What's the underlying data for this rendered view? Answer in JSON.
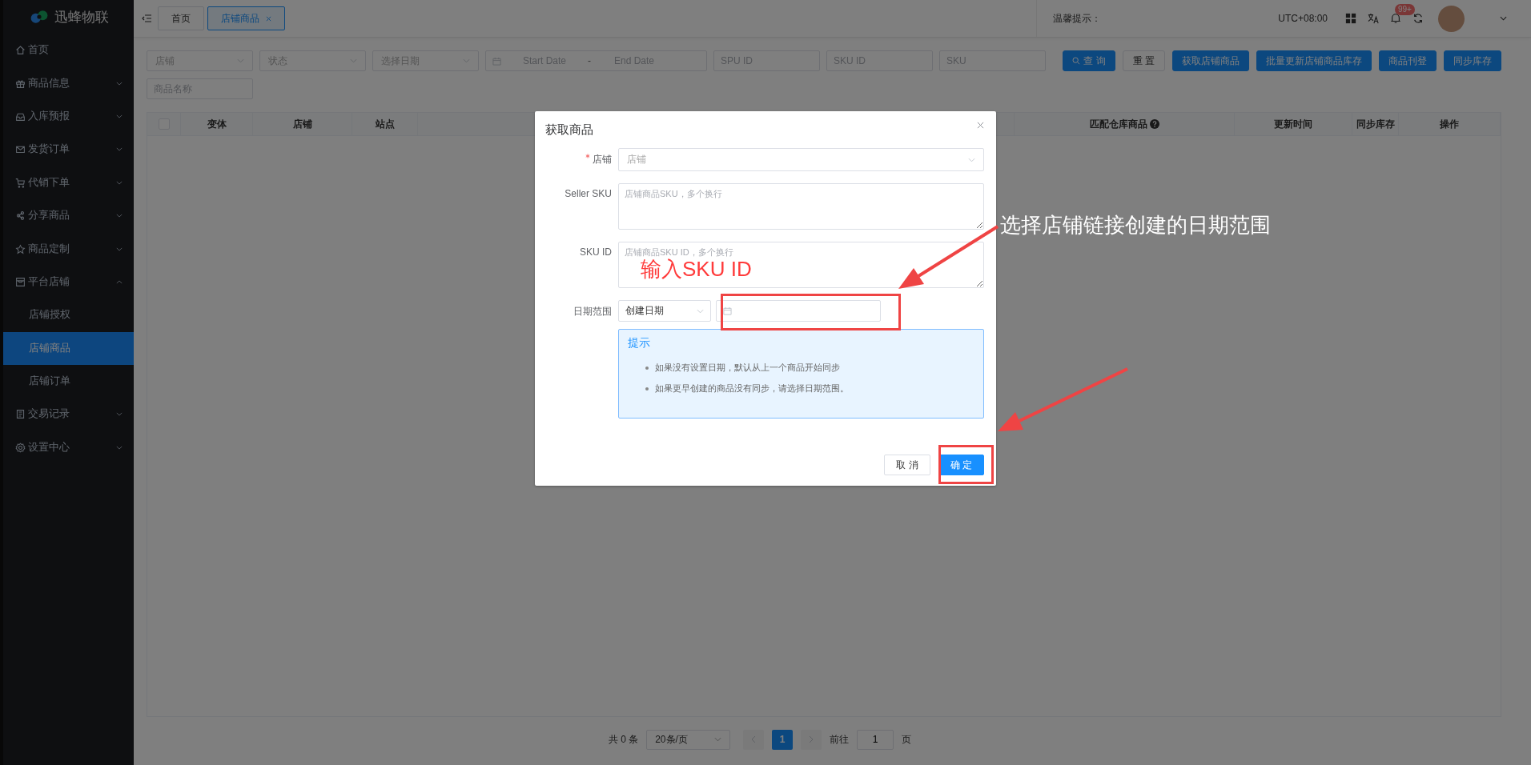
{
  "brand": {
    "name": "迅蜂物联"
  },
  "sidebar": {
    "items": [
      {
        "kind": "link",
        "label": "首页"
      },
      {
        "kind": "group",
        "label": "商品信息",
        "expanded": false
      },
      {
        "kind": "group",
        "label": "入库预报",
        "expanded": false
      },
      {
        "kind": "group",
        "label": "发货订单",
        "expanded": false
      },
      {
        "kind": "group",
        "label": "代销下单",
        "expanded": false
      },
      {
        "kind": "group",
        "label": "分享商品",
        "expanded": false
      },
      {
        "kind": "group",
        "label": "商品定制",
        "expanded": false
      },
      {
        "kind": "group",
        "label": "平台店铺",
        "expanded": true,
        "children": [
          {
            "label": "店铺授权",
            "selected": false
          },
          {
            "label": "店铺商品",
            "selected": true
          },
          {
            "label": "店铺订单",
            "selected": false
          }
        ]
      },
      {
        "kind": "group",
        "label": "交易记录",
        "expanded": false
      },
      {
        "kind": "group",
        "label": "设置中心",
        "expanded": false
      }
    ]
  },
  "tabs": [
    {
      "label": "首页",
      "selected": false,
      "closable": false
    },
    {
      "label": "店铺商品",
      "selected": true,
      "closable": true
    }
  ],
  "header": {
    "notice_label": "温馨提示：",
    "timezone": "UTC+08:00",
    "notification_badge": "99+"
  },
  "filters": [
    {
      "kind": "select",
      "placeholder": "店铺"
    },
    {
      "kind": "select",
      "placeholder": "状态"
    },
    {
      "kind": "select",
      "placeholder": "选择日期"
    },
    {
      "kind": "daterange",
      "start_placeholder": "Start Date",
      "separator": "-",
      "end_placeholder": "End Date"
    },
    {
      "kind": "input",
      "placeholder": "SPU ID"
    },
    {
      "kind": "input",
      "placeholder": "SKU ID"
    },
    {
      "kind": "input",
      "placeholder": "SKU"
    },
    {
      "kind": "input",
      "placeholder": "商品名称"
    }
  ],
  "actions": [
    {
      "kind": "search",
      "label": "查 询"
    },
    {
      "kind": "default",
      "label": "重 置"
    },
    {
      "kind": "primary",
      "label": "获取店铺商品"
    },
    {
      "kind": "primary",
      "label": "批量更新店铺商品库存"
    },
    {
      "kind": "primary",
      "label": "商品刊登"
    },
    {
      "kind": "primary",
      "label": "同步库存"
    }
  ],
  "table": {
    "select_all": {
      "checked": false
    },
    "columns": [
      {
        "label": "变体",
        "help": false
      },
      {
        "label": "店铺",
        "help": false
      },
      {
        "label": "站点",
        "help": false
      },
      {
        "label": "匹配仓库商品",
        "help": true
      },
      {
        "label": "更新时间",
        "help": false
      },
      {
        "label": "同步库存",
        "help": false
      },
      {
        "label": "操作",
        "help": false
      }
    ]
  },
  "pagination": {
    "total": "共 0 条",
    "page_size": "20条/页",
    "pages": [
      {
        "label": "1",
        "selected": true
      }
    ],
    "goto_label": "前往",
    "goto_value": "1",
    "goto_suffix": "页"
  },
  "dialog": {
    "title": "获取商品",
    "fields": [
      {
        "kind": "select",
        "label": "店铺",
        "required": true,
        "placeholder": "店铺"
      },
      {
        "kind": "textarea",
        "label": "Seller SKU",
        "required": false,
        "placeholder": "店铺商品SKU，多个换行"
      },
      {
        "kind": "textarea",
        "label": "SKU ID",
        "required": false,
        "placeholder": "店铺商品SKU ID，多个换行"
      },
      {
        "kind": "daterange",
        "label": "日期范围",
        "required": false,
        "value": "创建日期"
      }
    ],
    "tip": {
      "title": "提示",
      "items": [
        "如果没有设置日期，默认从上一个商品开始同步",
        "如果更早创建的商品没有同步，请选择日期范围。"
      ]
    },
    "buttons": [
      {
        "kind": "default",
        "label": "取 消"
      },
      {
        "kind": "primary",
        "label": "确 定"
      }
    ]
  },
  "annotations": [
    {
      "text": "输入SKU ID",
      "color": "#ff3b3b"
    },
    {
      "text": "选择店铺链接创建的日期范围",
      "color": "#ffffff"
    }
  ]
}
